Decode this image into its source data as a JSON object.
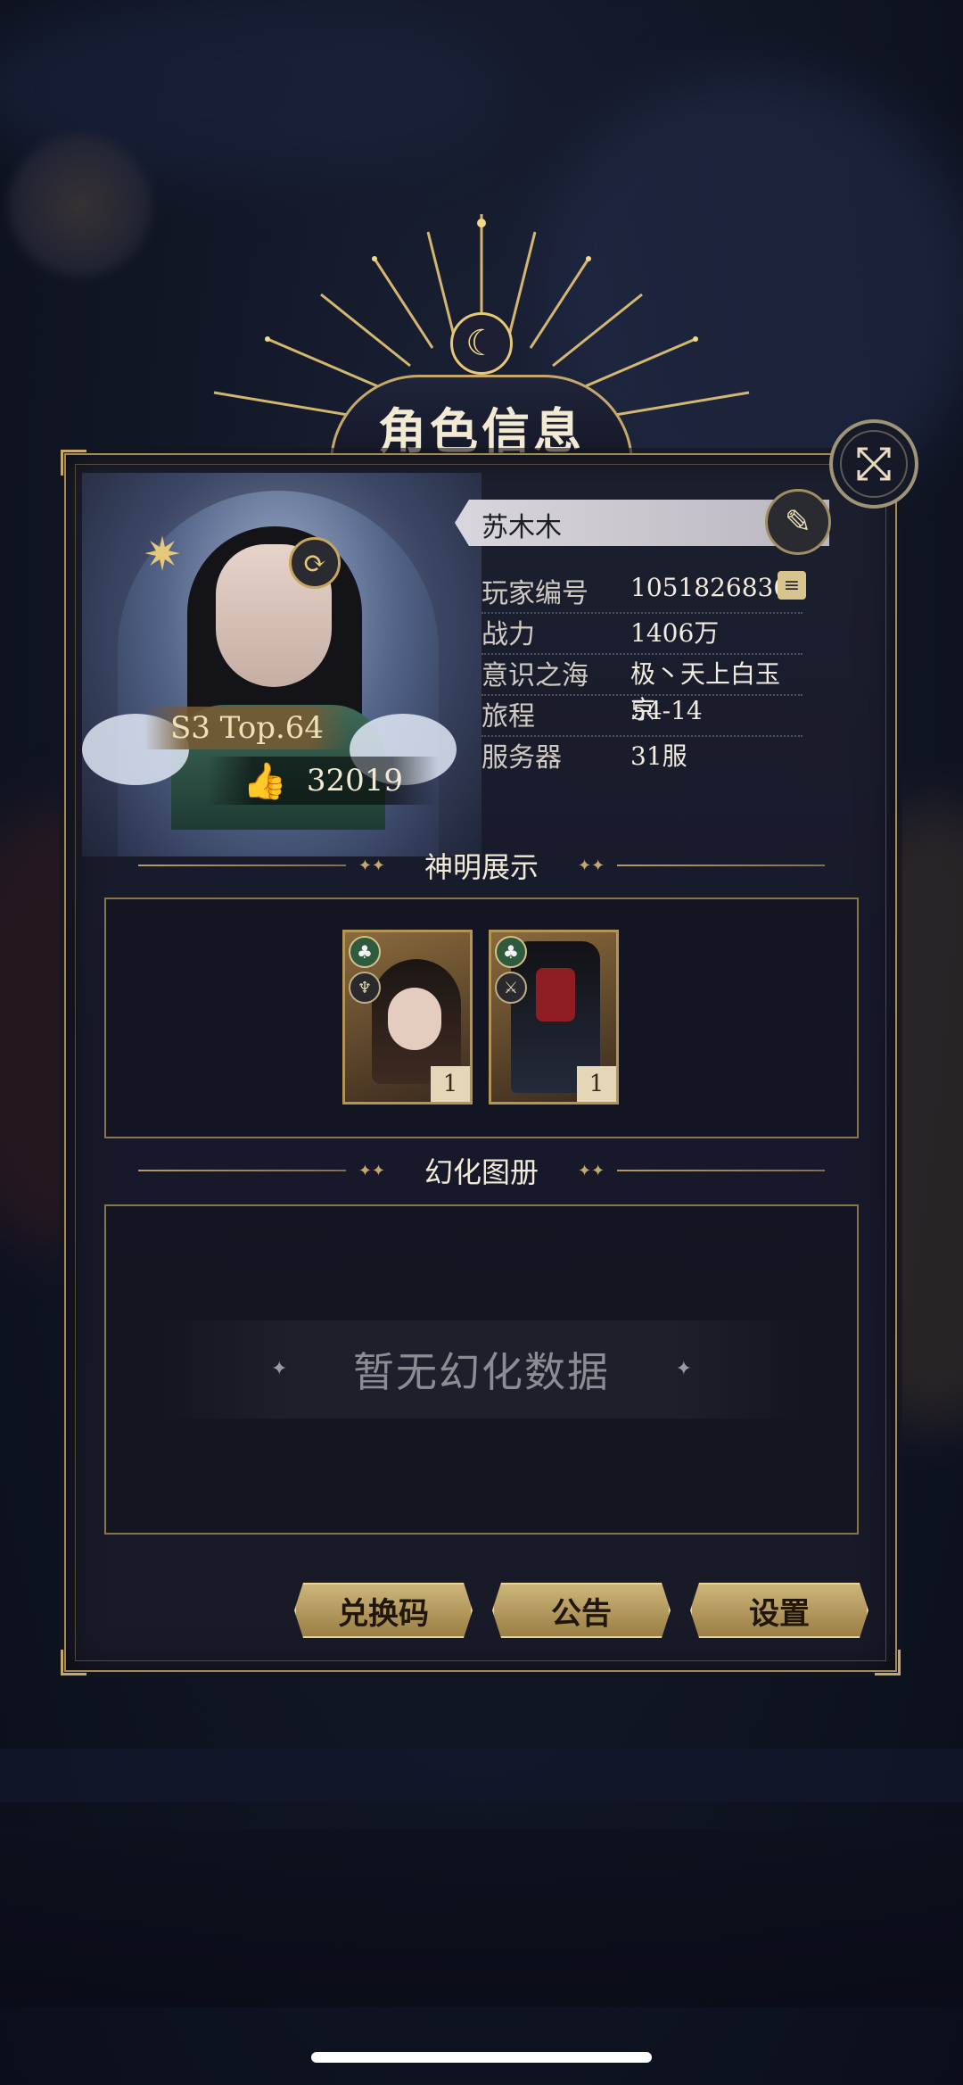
{
  "dialog": {
    "title": "角色信息"
  },
  "player": {
    "name": "苏木木",
    "rank_badge": "S3 Top.64",
    "likes": "32019"
  },
  "info_rows": [
    {
      "label": "玩家编号",
      "value": "10518268368"
    },
    {
      "label": "战力",
      "value": "1406万"
    },
    {
      "label": "意识之海",
      "value": "极丶天上白玉京"
    },
    {
      "label": "旅程",
      "value": "54-14"
    },
    {
      "label": "服务器",
      "value": "31服"
    }
  ],
  "sections": {
    "gods_title": "神明展示",
    "illusion_title": "幻化图册",
    "illusion_empty": "暂无幻化数据"
  },
  "god_cards": [
    {
      "level": "1",
      "icons": [
        "club-icon",
        "rune-icon"
      ]
    },
    {
      "level": "1",
      "icons": [
        "club-icon",
        "crossed-swords-icon"
      ]
    }
  ],
  "actions": {
    "redeem_label": "兑换码",
    "notice_label": "公告",
    "settings_label": "设置"
  },
  "colors": {
    "gold_accent": "#c6a86a",
    "panel_bg": "#1c1f2e",
    "button_gold": "#cdb57a"
  }
}
